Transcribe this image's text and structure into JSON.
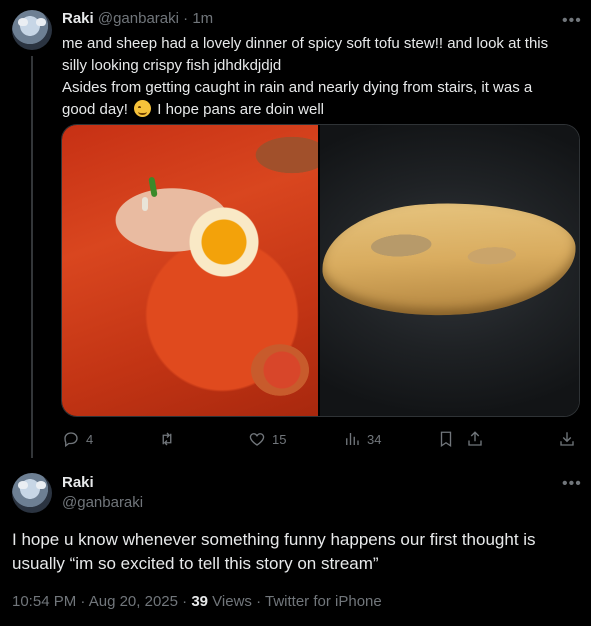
{
  "tweet1": {
    "name": "Raki",
    "handle": "@ganbaraki",
    "sep": " · ",
    "time": "1m",
    "more": "•••",
    "lines": [
      "me and sheep had a lovely dinner of spicy soft tofu stew!! and look at this",
      "silly looking crispy fish jdhdkdjdjd",
      "Asides from getting caught in rain and nearly dying from stairs, it was a",
      "good day!",
      " I hope pans are doin well"
    ],
    "emoji_icon": "smiling-face-emoji",
    "images": [
      "spicy-tofu-stew-photo",
      "crispy-fish-photo"
    ],
    "actions": {
      "replies": "4",
      "reposts": "",
      "likes": "15",
      "views": "34"
    }
  },
  "tweet2": {
    "name": "Raki",
    "handle": "@ganbaraki",
    "more": "•••",
    "lines": [
      "I hope u know whenever something funny happens our first thought is",
      "usually “im so excited to tell this story on stream”"
    ],
    "meta": {
      "time": "10:54 PM",
      "sep1": " · ",
      "date": "Aug 20, 2025",
      "sep2": " · ",
      "views_count": "39",
      "views_label": " Views",
      "sep3": " · ",
      "source": "Twitter for iPhone"
    }
  },
  "colors": {
    "background": "#000000",
    "text": "#e7e9ea",
    "muted": "#71767b",
    "thread_line": "#333639"
  }
}
